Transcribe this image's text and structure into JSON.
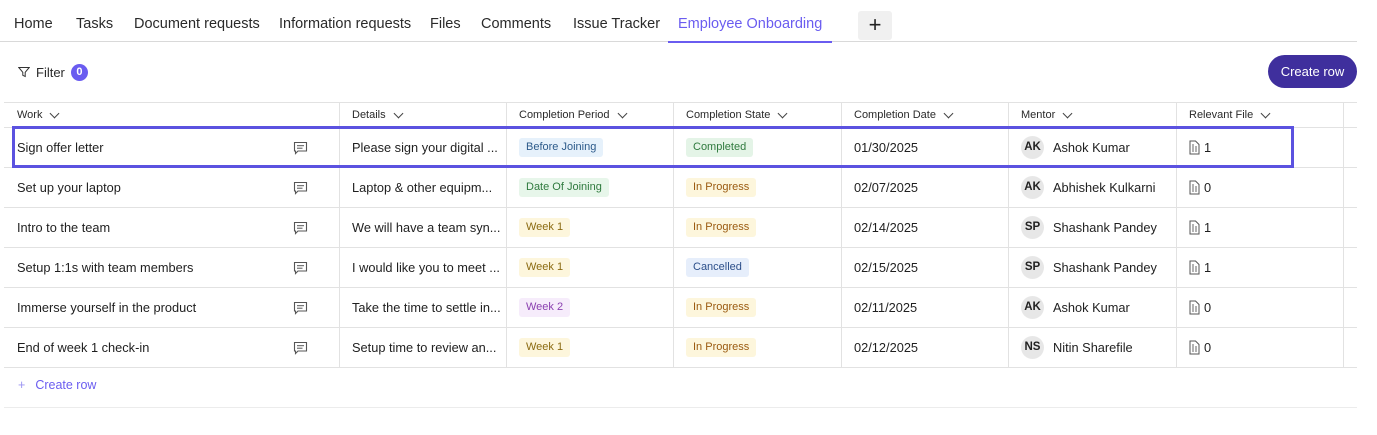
{
  "tabs": [
    {
      "label": "Home"
    },
    {
      "label": "Tasks"
    },
    {
      "label": "Document requests"
    },
    {
      "label": "Information requests"
    },
    {
      "label": "Files"
    },
    {
      "label": "Comments"
    },
    {
      "label": "Issue Tracker"
    },
    {
      "label": "Employee Onboarding",
      "active": true
    }
  ],
  "add_tab_label": "+",
  "toolbar": {
    "filter_label": "Filter",
    "filter_count": "0",
    "create_row_label": "Create row"
  },
  "columns": [
    "Work",
    "Details",
    "Completion Period",
    "Completion State",
    "Completion Date",
    "Mentor",
    "Relevant File"
  ],
  "rows": [
    {
      "work": "Sign offer letter",
      "details": "Please sign your digital ...",
      "period": "Before Joining",
      "state": "Completed",
      "date": "01/30/2025",
      "mentor_initials": "AK",
      "mentor": "Ashok Kumar",
      "files": "1"
    },
    {
      "work": "Set up your laptop",
      "details": "Laptop & other equipm...",
      "period": "Date Of Joining",
      "state": "In Progress",
      "date": "02/07/2025",
      "mentor_initials": "AK",
      "mentor": "Abhishek Kulkarni",
      "files": "0"
    },
    {
      "work": "Intro to the team",
      "details": "We will have a team syn...",
      "period": "Week 1",
      "state": "In Progress",
      "date": "02/14/2025",
      "mentor_initials": "SP",
      "mentor": "Shashank Pandey",
      "files": "1"
    },
    {
      "work": "Setup 1:1s with team members",
      "details": "I would like you to meet ...",
      "period": "Week 1",
      "state": "Cancelled",
      "date": "02/15/2025",
      "mentor_initials": "SP",
      "mentor": "Shashank Pandey",
      "files": "1"
    },
    {
      "work": "Immerse yourself in the product",
      "details": "Take the time to settle in...",
      "period": "Week 2",
      "state": "In Progress",
      "date": "02/11/2025",
      "mentor_initials": "AK",
      "mentor": "Ashok Kumar",
      "files": "0"
    },
    {
      "work": "End of week 1 check-in",
      "details": "Setup time to review an...",
      "period": "Week 1",
      "state": "In Progress",
      "date": "02/12/2025",
      "mentor_initials": "NS",
      "mentor": "Nitin Sharefile",
      "files": "0"
    }
  ],
  "pill_colors": {
    "Before Joining": {
      "bg": "#e6f1fb",
      "fg": "#2c5a8a"
    },
    "Date Of Joining": {
      "bg": "#e7f6ea",
      "fg": "#2f7a3e"
    },
    "Week 1": {
      "bg": "#fdf6dc",
      "fg": "#8a6a10"
    },
    "Week 2": {
      "bg": "#f6ecfb",
      "fg": "#8a3fb0"
    },
    "Completed": {
      "bg": "#e4f4e7",
      "fg": "#2f7a3e"
    },
    "In Progress": {
      "bg": "#fdf6dc",
      "fg": "#9a5a10"
    },
    "Cancelled": {
      "bg": "#e6eefb",
      "fg": "#2c4f8a"
    }
  },
  "add_row_plus": "+",
  "add_row_label": "Create row",
  "accent_color": "#6a5cf0",
  "selected_row_index": 0
}
